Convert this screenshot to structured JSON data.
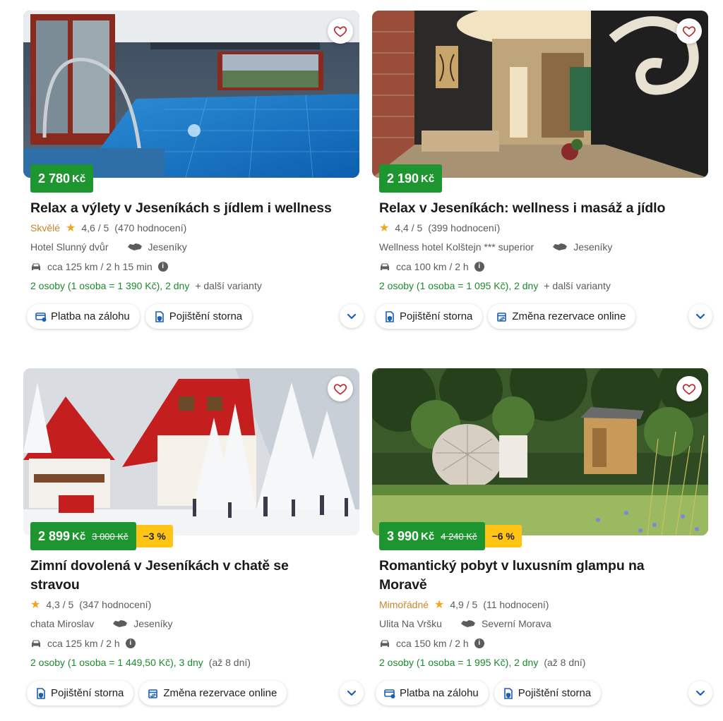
{
  "cards": [
    {
      "price": "2 780",
      "currency": "Kč",
      "old_price": "",
      "discount": "",
      "title": "Relax a výlety v Jeseníkách s jídlem i wellness",
      "rating_word": "Skvělé",
      "rating": "4,6 / 5",
      "reviews": "(470 hodnocení)",
      "hotel": "Hotel Slunný dvůr",
      "region": "Jeseníky",
      "distance": "cca 125 km / 2 h 15 min",
      "offer": "2 osoby (1 osoba = 1 390 Kč), 2 dny",
      "extra": "+ další varianty",
      "chips": [
        "Platba na zálohu",
        "Pojištění storna"
      ]
    },
    {
      "price": "2 190",
      "currency": "Kč",
      "old_price": "",
      "discount": "",
      "title": "Relax v Jeseníkách: wellness i masáž a jídlo",
      "rating_word": "",
      "rating": "4,4 / 5",
      "reviews": "(399 hodnocení)",
      "hotel": "Wellness hotel Kolštejn *** superior",
      "region": "Jeseníky",
      "distance": "cca 100 km / 2 h",
      "offer": "2 osoby (1 osoba = 1 095 Kč), 2 dny",
      "extra": "+ další varianty",
      "chips": [
        "Pojištění storna",
        "Změna rezervace online"
      ]
    },
    {
      "price": "2 899",
      "currency": "Kč",
      "old_price": "3 000 Kč",
      "discount": "−3 %",
      "title": "Zimní dovolená v Jeseníkách v chatě se stravou",
      "rating_word": "",
      "rating": "4,3 / 5",
      "reviews": "(347 hodnocení)",
      "hotel": "chata Miroslav",
      "region": "Jeseníky",
      "distance": "cca 125 km / 2 h",
      "offer": "2 osoby (1 osoba = 1 449,50 Kč), 3 dny",
      "extra": "(až 8 dní)",
      "chips": [
        "Pojištění storna",
        "Změna rezervace online"
      ]
    },
    {
      "price": "3 990",
      "currency": "Kč",
      "old_price": "4 240 Kč",
      "discount": "−6 %",
      "title": "Romantický pobyt v luxusním glampu na Moravě",
      "rating_word": "Mimořádné",
      "rating": "4,9 / 5",
      "reviews": "(11 hodnocení)",
      "hotel": "Ulita Na Vršku",
      "region": "Severní Morava",
      "distance": "cca 150 km / 2 h",
      "offer": "2 osoby (1 osoba = 1 995 Kč), 2 dny",
      "extra": "(až 8 dní)",
      "chips": [
        "Platba na zálohu",
        "Pojištění storna"
      ]
    }
  ],
  "icons": {
    "favorite": "heart-icon",
    "rating": "star-icon",
    "region": "map-region-icon",
    "distance": "car-icon",
    "info": "info-icon",
    "deposit": "card-payment-icon",
    "insurance": "insurance-icon",
    "rebooking": "calendar-change-icon",
    "expand": "chevron-down-icon"
  },
  "colors": {
    "price_bg": "#1e9630",
    "discount_bg": "#ffc414",
    "offer_text": "#1e8a2e",
    "rating_word": "#c8862a",
    "star": "#f1a51c",
    "accent": "#1a5fb4"
  }
}
